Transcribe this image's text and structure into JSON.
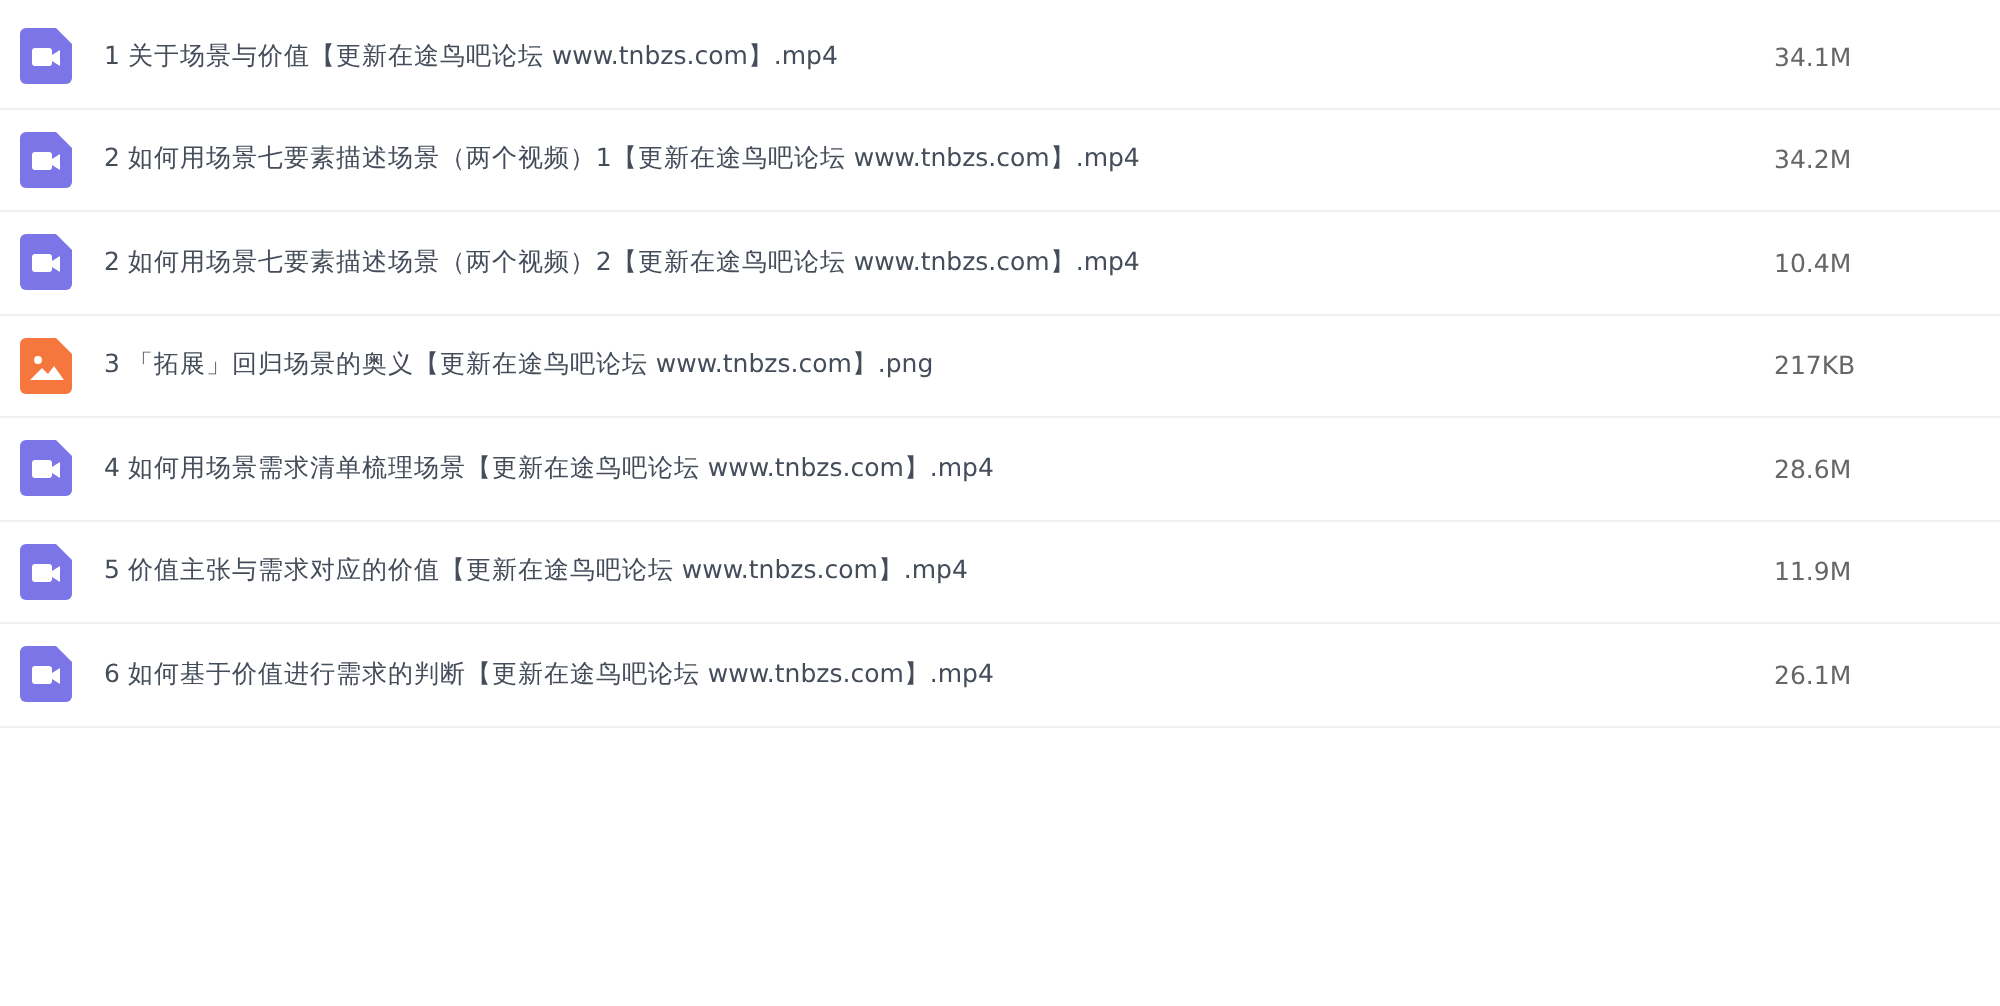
{
  "files": [
    {
      "kind": "video",
      "name": "1 关于场景与价值【更新在途鸟吧论坛 www.tnbzs.com】.mp4",
      "size": "34.1M"
    },
    {
      "kind": "video",
      "name": "2 如何用场景七要素描述场景（两个视频）1【更新在途鸟吧论坛 www.tnbzs.com】.mp4",
      "size": "34.2M"
    },
    {
      "kind": "video",
      "name": "2 如何用场景七要素描述场景（两个视频）2【更新在途鸟吧论坛 www.tnbzs.com】.mp4",
      "size": "10.4M"
    },
    {
      "kind": "image",
      "name": "3 「拓展」回归场景的奥义【更新在途鸟吧论坛 www.tnbzs.com】.png",
      "size": "217KB"
    },
    {
      "kind": "video",
      "name": "4 如何用场景需求清单梳理场景【更新在途鸟吧论坛 www.tnbzs.com】.mp4",
      "size": "28.6M"
    },
    {
      "kind": "video",
      "name": "5 价值主张与需求对应的价值【更新在途鸟吧论坛 www.tnbzs.com】.mp4",
      "size": "11.9M"
    },
    {
      "kind": "video",
      "name": "6 如何基于价值进行需求的判断【更新在途鸟吧论坛 www.tnbzs.com】.mp4",
      "size": "26.1M"
    }
  ]
}
